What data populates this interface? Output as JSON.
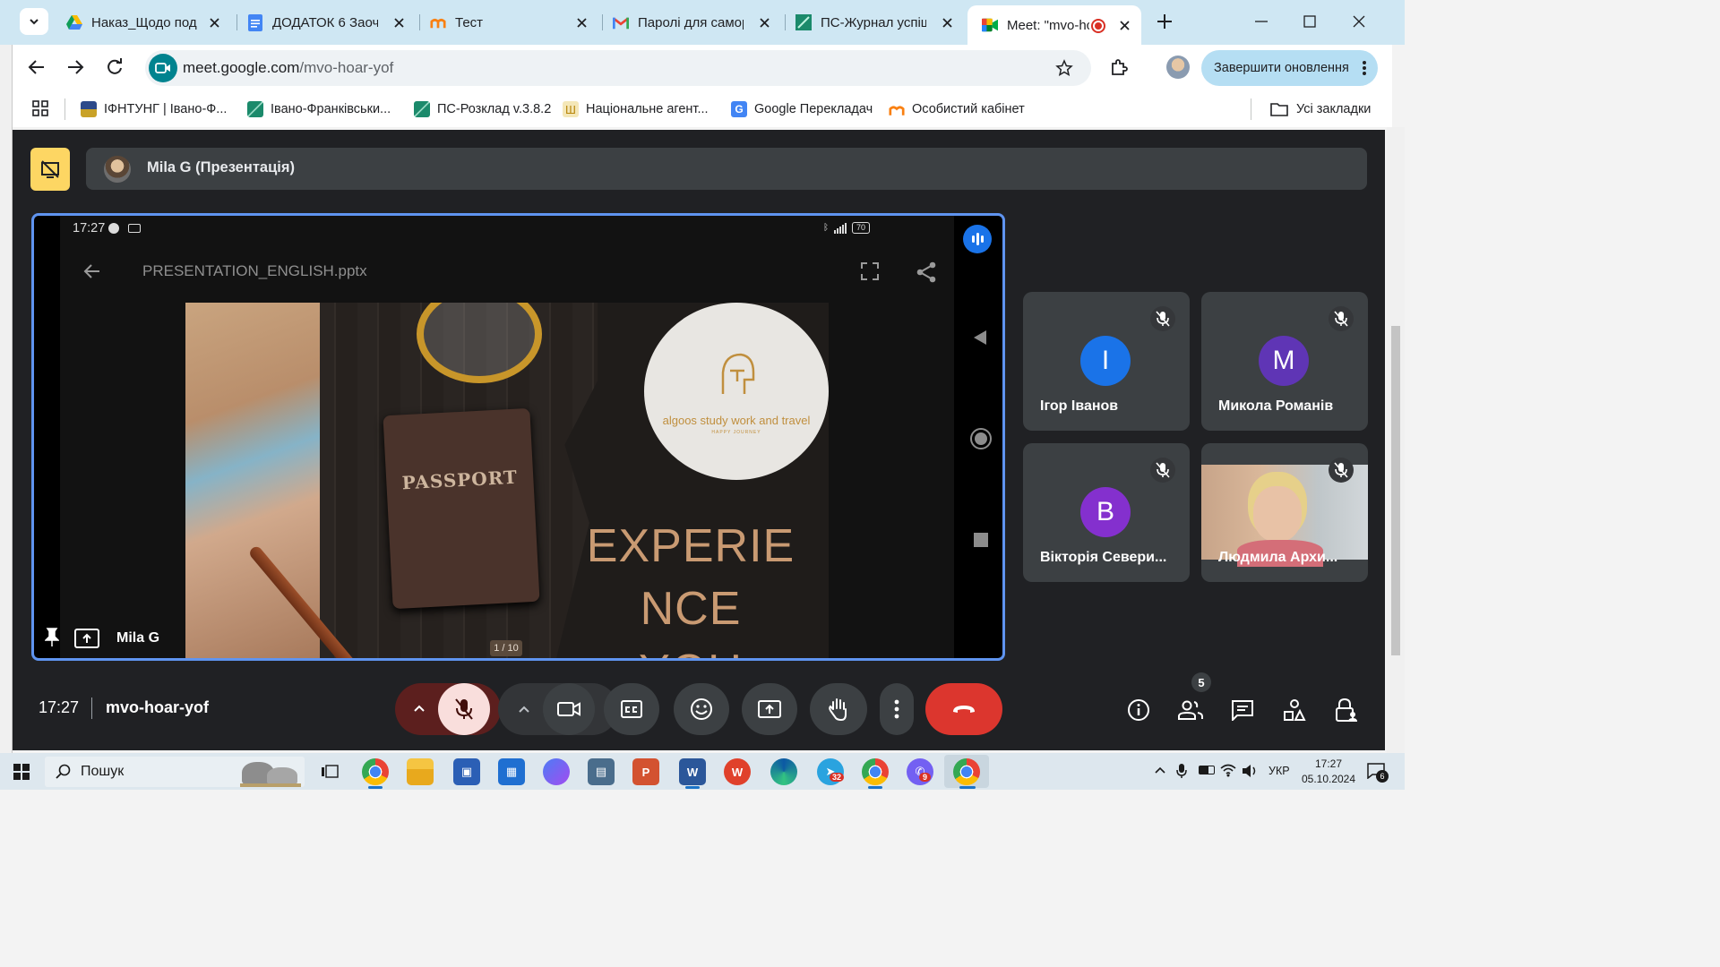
{
  "tabs": [
    {
      "title": "Наказ_Щодо поді",
      "icon": "google-drive-icon"
    },
    {
      "title": "ДОДАТОК 6 Заоч",
      "icon": "google-docs-icon"
    },
    {
      "title": "Тест",
      "icon": "moodle-icon"
    },
    {
      "title": "Паролі для самор",
      "icon": "gmail-icon"
    },
    {
      "title": "ПС-Журнал успіш",
      "icon": "ps-journal-icon"
    },
    {
      "title": "Meet: \"mvo-hc",
      "icon": "google-meet-icon",
      "recording": true
    }
  ],
  "address": {
    "host": "meet.google.com",
    "path": "/mvo-hoar-yof"
  },
  "update_button": "Завершити оновлення",
  "bookmarks": [
    {
      "label": "ІФНТУНГ | Івано-Ф...",
      "icon": "university-icon"
    },
    {
      "label": "Івано-Франківськи...",
      "icon": "ps-icon"
    },
    {
      "label": "ПС-Розклад v.3.8.2",
      "icon": "ps-icon"
    },
    {
      "label": "Національне агент...",
      "icon": "trident-icon"
    },
    {
      "label": "Google Перекладач",
      "icon": "translate-icon"
    },
    {
      "label": "Особистий кабінет",
      "icon": "moodle-icon"
    }
  ],
  "all_bookmarks": "Усі закладки",
  "presenter_bar": {
    "name": "Mila G (Презентація)"
  },
  "shared_screen": {
    "phone_time": "17:27",
    "battery": "70",
    "file_name": "PRESENTATION_ENGLISH.pptx",
    "slide_counter": "1 / 10",
    "slide": {
      "passport": "PASSPORT",
      "logo_text": "algoos study work and travel",
      "logo_sub": "HAPPY JOURNEY",
      "headline_1": "EXPERIE",
      "headline_2": "NCE",
      "headline_3": "YOU"
    }
  },
  "presenter_label": "Mila G",
  "participants": [
    {
      "name": "Ігор Іванов",
      "initial": "І",
      "color": "#1a73e8",
      "muted": true
    },
    {
      "name": "Микола Романів",
      "initial": "M",
      "color": "#5f35b5",
      "muted": true
    },
    {
      "name": "Вікторія Севери...",
      "initial": "B",
      "color": "#8430ce",
      "muted": true
    },
    {
      "name": "Людмила Архи...",
      "initial": "",
      "color": "",
      "muted": true,
      "video": true
    }
  ],
  "footer": {
    "time": "17:27",
    "meeting_code": "mvo-hoar-yof",
    "people_count": "5"
  },
  "taskbar": {
    "search": "Пошук",
    "lang": "УКР",
    "time": "17:27",
    "date": "05.10.2024",
    "notifications": "6",
    "telegram_badge": "32",
    "viber_badge": "9"
  }
}
